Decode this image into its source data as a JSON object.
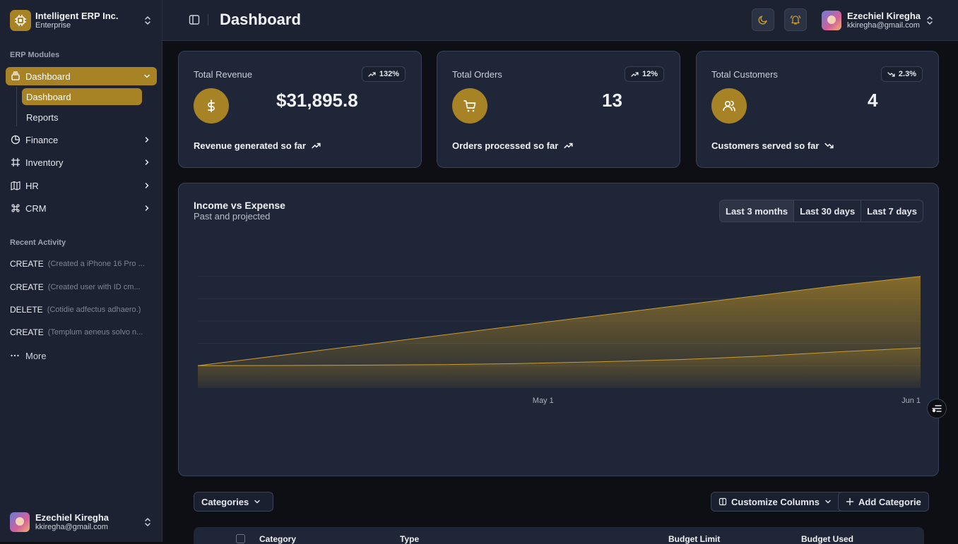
{
  "sidebar": {
    "org": {
      "name": "Intelligent ERP Inc.",
      "plan": "Enterprise"
    },
    "modules_label": "ERP Modules",
    "nav": [
      {
        "label": "Dashboard",
        "icon": "stack-icon",
        "expanded": true
      },
      {
        "label": "Finance",
        "icon": "pie-chart-icon"
      },
      {
        "label": "Inventory",
        "icon": "frame-icon"
      },
      {
        "label": "HR",
        "icon": "map-icon"
      },
      {
        "label": "CRM",
        "icon": "command-icon"
      }
    ],
    "sub_nav": [
      {
        "label": "Dashboard",
        "active": true
      },
      {
        "label": "Reports"
      }
    ],
    "recent_label": "Recent Activity",
    "activity": [
      {
        "verb": "CREATE",
        "desc": "(Created a iPhone 16 Pro ..."
      },
      {
        "verb": "CREATE",
        "desc": "(Created user with ID cm..."
      },
      {
        "verb": "DELETE",
        "desc": "(Cotidie adfectus adhaero.)"
      },
      {
        "verb": "CREATE",
        "desc": "(Templum aeneus solvo n..."
      }
    ],
    "more_label": "More",
    "user": {
      "name": "Ezechiel Kiregha",
      "email": "kkiregha@gmail.com"
    }
  },
  "header": {
    "title": "Dashboard",
    "user": {
      "name": "Ezechiel Kiregha",
      "email": "kkiregha@gmail.com"
    }
  },
  "kpis": [
    {
      "title": "Total Revenue",
      "badge": "132%",
      "trend": "up",
      "value": "$31,895.8",
      "footer": "Revenue generated so far",
      "icon": "dollar-icon"
    },
    {
      "title": "Total Orders",
      "badge": "12%",
      "trend": "up",
      "value": "13",
      "footer": "Orders processed so far",
      "icon": "cart-icon"
    },
    {
      "title": "Total Customers",
      "badge": "2.3%",
      "trend": "down",
      "value": "4",
      "footer": "Customers served so far",
      "icon": "users-icon"
    }
  ],
  "chart_panel": {
    "title": "Income vs Expense",
    "subtitle": "Past and projected",
    "ranges": [
      "Last 3 months",
      "Last 30 days",
      "Last 7 days"
    ],
    "selected_range": "Last 3 months"
  },
  "chart_data": {
    "type": "area",
    "x": [
      "Apr 1",
      "Apr 8",
      "Apr 15",
      "Apr 22",
      "Apr 29",
      "May 6",
      "May 13",
      "May 20",
      "May 27",
      "Jun 1"
    ],
    "x_tick_labels": [
      "May 1",
      "Jun 1"
    ],
    "series": [
      {
        "values": [
          0,
          9,
          18,
          27,
          36,
          45,
          54,
          63,
          72,
          80
        ]
      },
      {
        "values": [
          0,
          0.2,
          0.5,
          1,
          2,
          3.5,
          5.5,
          8.5,
          12.5,
          16
        ]
      }
    ],
    "ylim": [
      -20,
      100
    ],
    "grid": true,
    "legend": "none",
    "colors": {
      "accent": "#a88326",
      "line": "#c89d33"
    }
  },
  "table": {
    "categories_label": "Categories",
    "customize_label": "Customize Columns",
    "add_label": "Add Categorie",
    "columns": [
      "Category",
      "Type",
      "Budget Limit",
      "Budget Used"
    ]
  },
  "colors": {
    "accent": "#a88326",
    "sidebar_bg": "#1c2232",
    "card_bg": "#1e2637",
    "page_bg": "#0d0f14"
  }
}
